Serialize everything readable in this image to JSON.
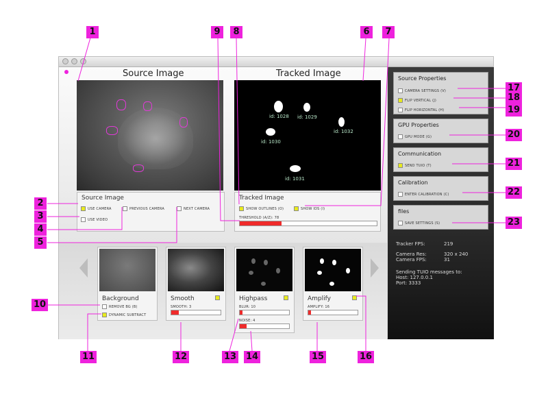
{
  "source_heading": "Source Image",
  "tracked_heading": "Tracked Image",
  "source_panel": {
    "title": "Source Image",
    "use_camera": "USE CAMERA",
    "previous_camera": "PREVIOUS CAMERA",
    "next_camera": "NEXT CAMERA",
    "use_video": "USE VIDEO"
  },
  "tracked_panel": {
    "title": "Tracked Image",
    "show_outlines": "SHOW OUTLINES (O)",
    "show_ids": "SHOW IDS (I)",
    "threshold": "THRESHOLD (A/Z): 78",
    "threshold_value": 78
  },
  "blobs": [
    "id: 1028",
    "id: 1029",
    "id: 1032",
    "id: 1030",
    "id: 1031"
  ],
  "filters": {
    "background": {
      "title": "Background",
      "remove_bg": "REMOVE BG (B)",
      "dynamic_subtract": "DYNAMIC SUBTRACT"
    },
    "smooth": {
      "title": "Smooth",
      "slider": "SMOOTH: 3",
      "value": 3
    },
    "highpass": {
      "title": "Highpass",
      "blur": "BLUR: 10",
      "noise": "NOISE: 4",
      "blur_value": 10,
      "noise_value": 4
    },
    "amplify": {
      "title": "Amplify",
      "slider": "AMPLIFY: 16",
      "value": 16
    }
  },
  "sidebar": {
    "source_properties": {
      "title": "Source Properties",
      "camera_settings": "CAMERA SETTINGS (V)",
      "flip_vertical": "FLIP VERTICAL (J)",
      "flip_horizontal": "FLIP HORIZONTAL (H)"
    },
    "gpu_properties": {
      "title": "GPU Properties",
      "gpu_mode": "GPU MODE (G)"
    },
    "communication": {
      "title": "Communication",
      "send_tuio": "SEND TUIO (T)"
    },
    "calibration": {
      "title": "Calibration",
      "enter_calibration": "ENTER CALIBRATION (C)"
    },
    "files": {
      "title": "files",
      "save_settings": "SAVE SETTINGS (S)"
    }
  },
  "stats": {
    "tracker_fps_label": "Tracker FPS:",
    "tracker_fps": "219",
    "camera_res_label": "Camera Res:",
    "camera_res": "320 x 240",
    "camera_fps_label": "Camera FPS:",
    "camera_fps": "31",
    "tuio_line": "Sending TUIO messages to:",
    "host": "Host: 127.0.0.1",
    "port": "Port: 3333"
  },
  "callouts": [
    "1",
    "2",
    "3",
    "4",
    "5",
    "6",
    "7",
    "8",
    "9",
    "10",
    "11",
    "12",
    "13",
    "14",
    "15",
    "16",
    "17",
    "18",
    "19",
    "20",
    "21",
    "22",
    "23"
  ],
  "colors": {
    "callout": "#ee22dd",
    "checked": "#e8ea1f",
    "slider_fill": "#ef2b2b",
    "label_green": "#b8e6c8"
  }
}
